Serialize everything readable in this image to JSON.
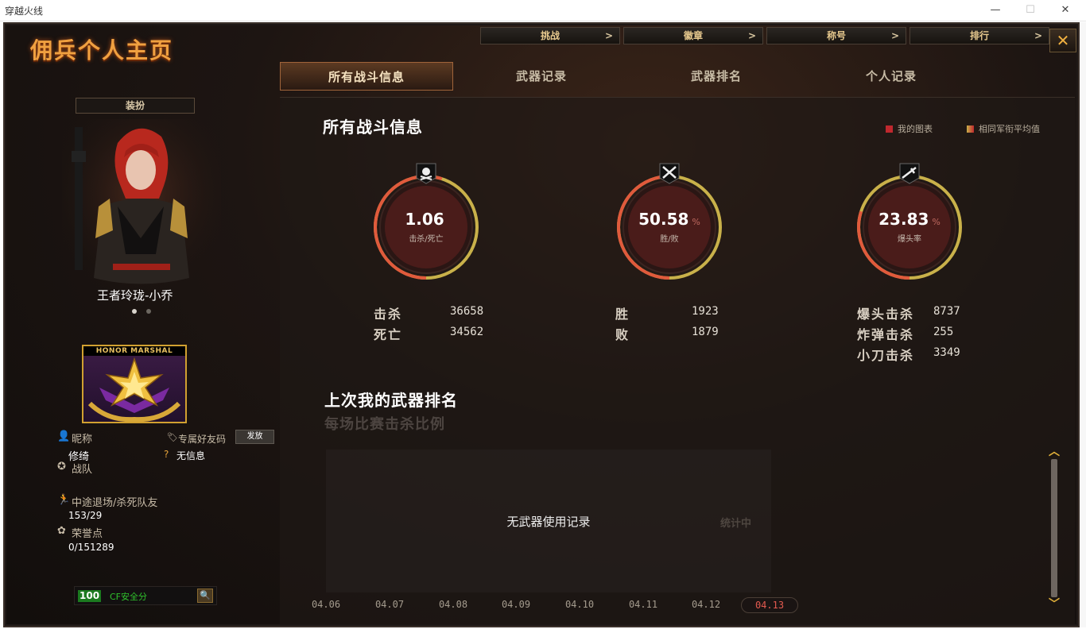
{
  "window": {
    "title": "穿越火线"
  },
  "header": {
    "logo": "佣兵个人主页",
    "top_tabs": [
      {
        "label": "挑战",
        "arrow": ">"
      },
      {
        "label": "徽章",
        "arrow": ">"
      },
      {
        "label": "称号",
        "arrow": ">"
      },
      {
        "label": "排行",
        "arrow": ">"
      }
    ],
    "close": "✕"
  },
  "tabs": [
    {
      "label": "所有战斗信息",
      "active": true
    },
    {
      "label": "武器记录",
      "active": false
    },
    {
      "label": "武器排名",
      "active": false
    },
    {
      "label": "个人记录",
      "active": false
    }
  ],
  "profile": {
    "dress_button": "装扮",
    "character_name": "王者玲珑-小乔",
    "badge_text": "HONOR MARSHAL",
    "nickname_label": "昵称",
    "nickname_value": "修绮",
    "friend_code_label": "专属好友码",
    "grant_button": "发放",
    "friend_code_value": "无信息",
    "team_label": "战队",
    "quit_label": "中途退场/杀死队友",
    "quit_value": "153/29",
    "honor_label": "荣誉点",
    "honor_value": "0/151289",
    "cf_score": "100",
    "cf_label": "CF安全分"
  },
  "battle": {
    "title": "所有战斗信息",
    "legend": [
      {
        "label": "我的图表",
        "color": "#c0282e"
      },
      {
        "label": "相同军衔平均值",
        "color": "#c9b14a"
      }
    ],
    "rings": [
      {
        "value": "1.06",
        "unit": "",
        "label": "击杀/死亡",
        "fill": 0.55
      },
      {
        "value": "50.58",
        "unit": "%",
        "label": "胜/败",
        "fill": 0.5058
      },
      {
        "value": "23.83",
        "unit": "%",
        "label": "爆头率",
        "fill": 0.3
      }
    ],
    "stats": {
      "kill_label": "击杀",
      "kill_value": "36658",
      "death_label": "死亡",
      "death_value": "34562",
      "win_label": "胜",
      "win_value": "1923",
      "lose_label": "败",
      "lose_value": "1879",
      "headshot_label": "爆头击杀",
      "headshot_value": "8737",
      "bomb_label": "炸弹击杀",
      "bomb_value": "255",
      "knife_label": "小刀击杀",
      "knife_value": "3349"
    }
  },
  "weapon": {
    "title": "上次我的武器排名",
    "subtitle": "每场比赛击杀比例",
    "empty_text": "无武器使用记录",
    "stat_text": "统计中",
    "dates": [
      "04.06",
      "04.07",
      "04.08",
      "04.09",
      "04.10",
      "04.11",
      "04.12",
      "04.13"
    ],
    "active_date": "04.13"
  }
}
